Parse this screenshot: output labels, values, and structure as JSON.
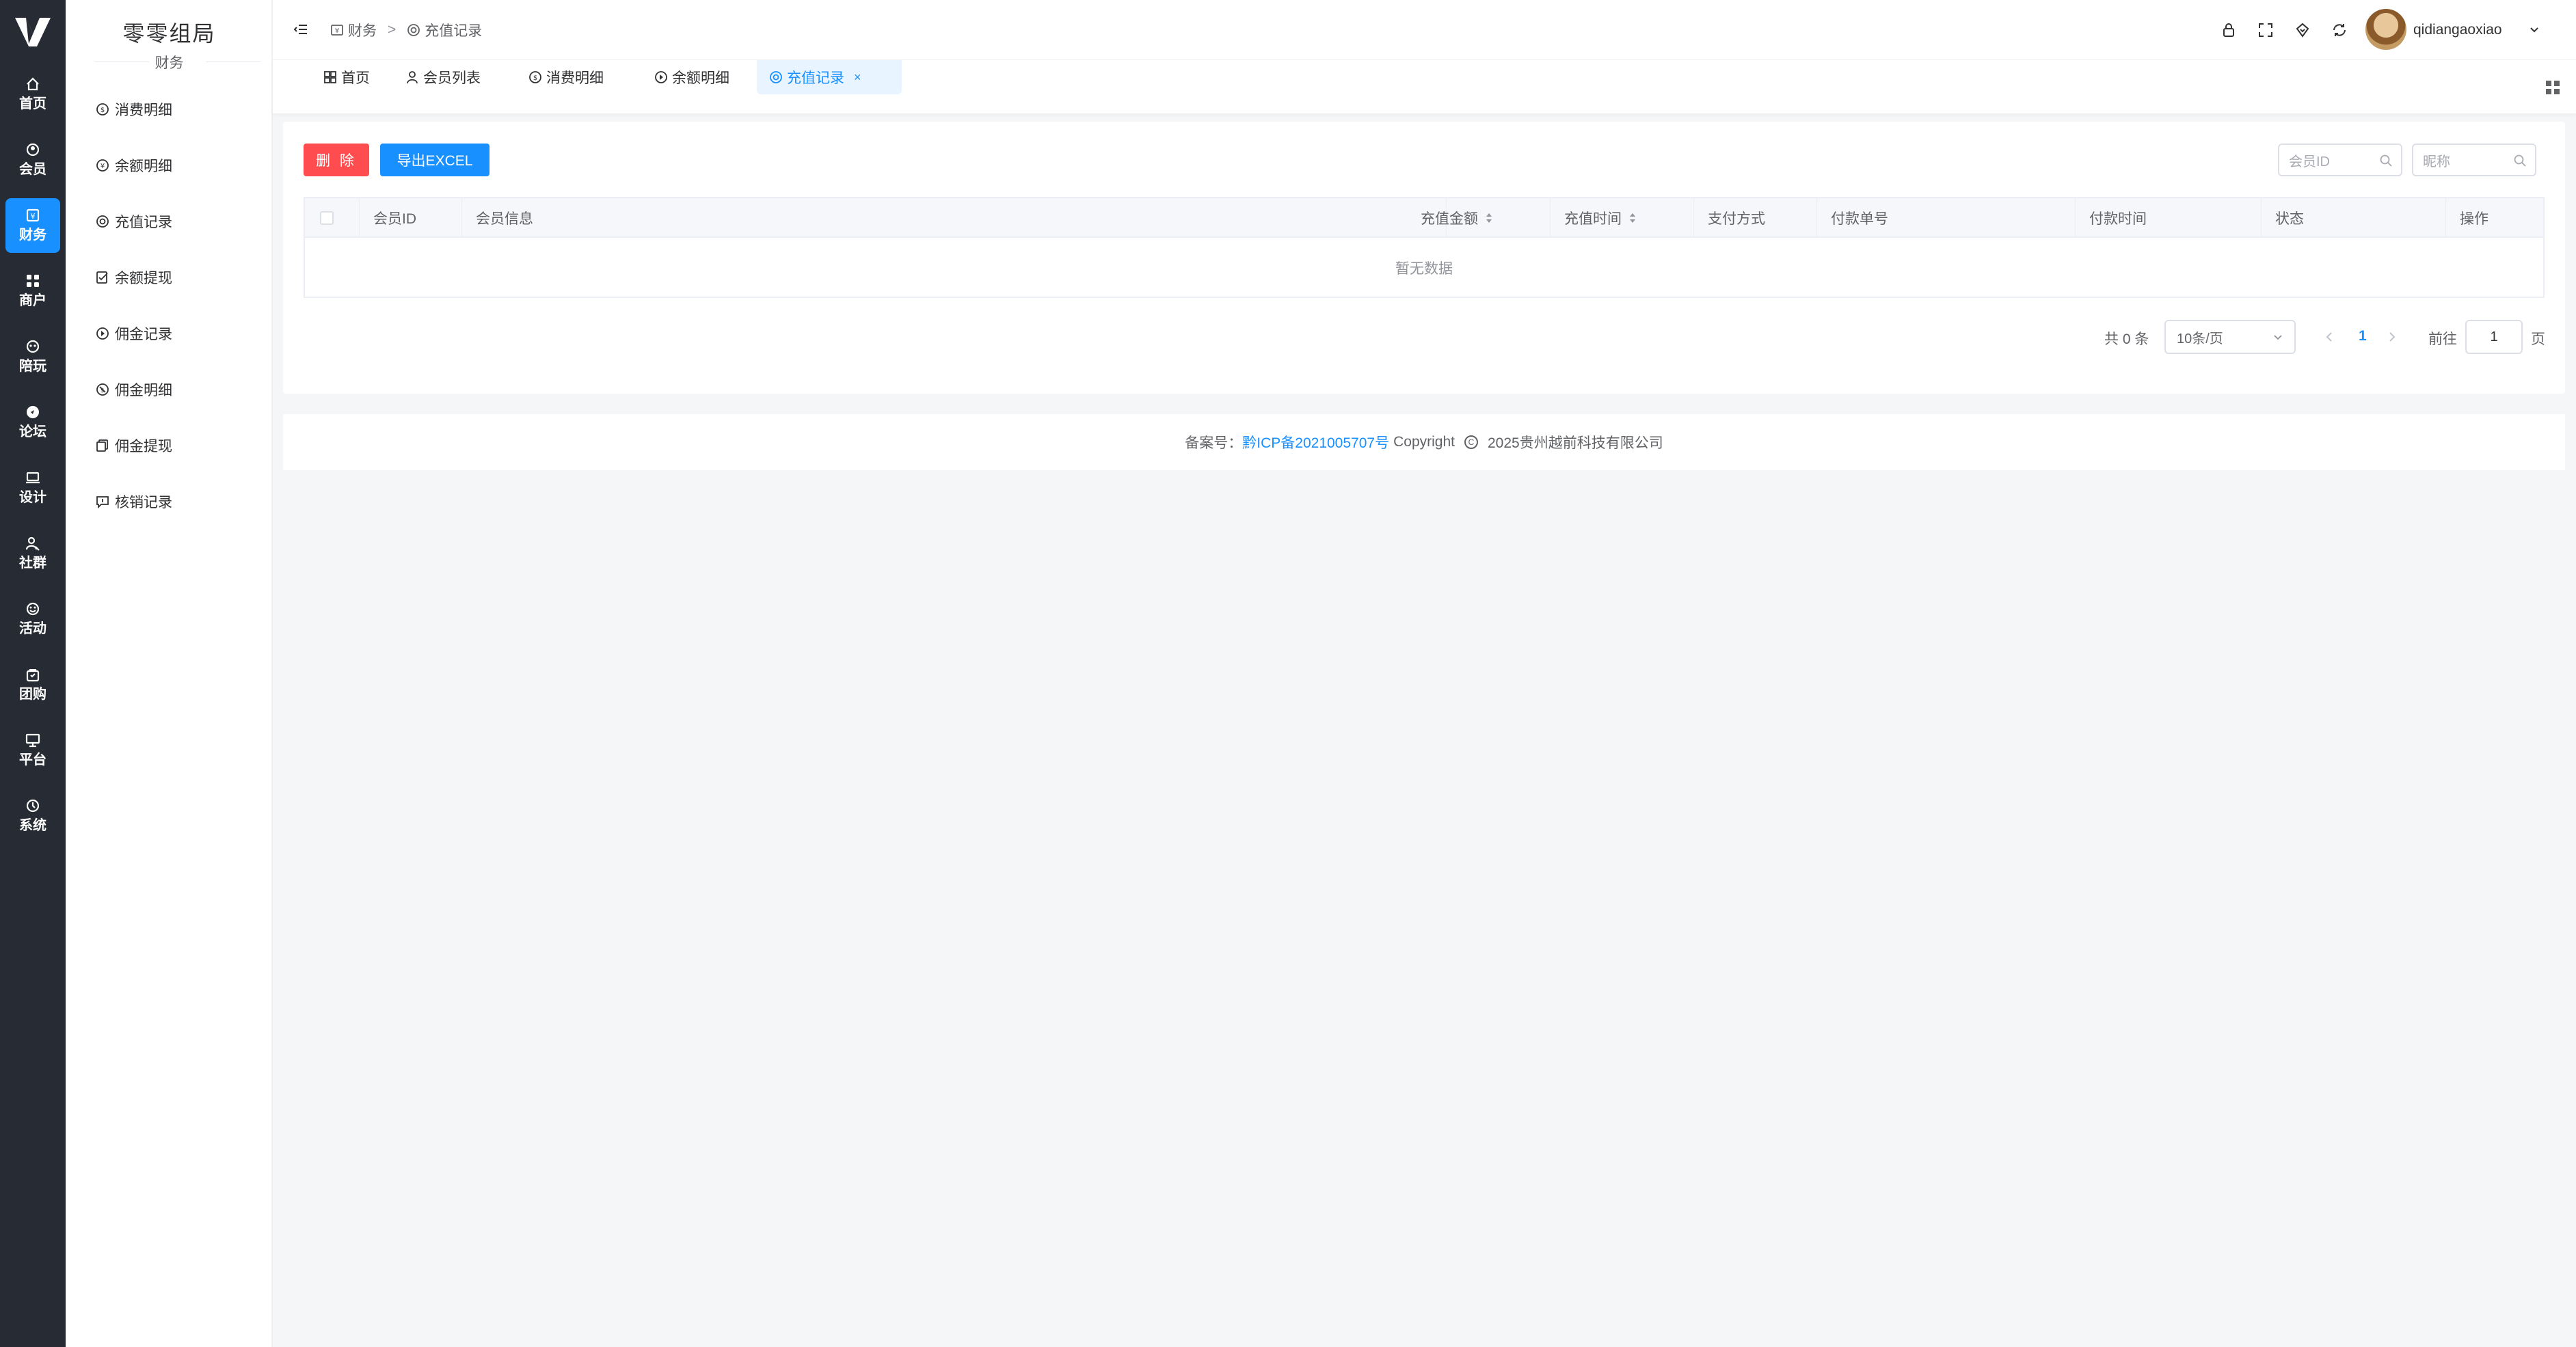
{
  "app": {
    "title": "零零组局",
    "section": "财务"
  },
  "rail": {
    "items": [
      {
        "label": "首页",
        "icon": "home-icon"
      },
      {
        "label": "会员",
        "icon": "member-icon"
      },
      {
        "label": "财务",
        "icon": "finance-icon",
        "active": true
      },
      {
        "label": "商户",
        "icon": "merchant-icon"
      },
      {
        "label": "陪玩",
        "icon": "companion-icon"
      },
      {
        "label": "论坛",
        "icon": "forum-icon"
      },
      {
        "label": "设计",
        "icon": "design-icon"
      },
      {
        "label": "社群",
        "icon": "community-icon"
      },
      {
        "label": "活动",
        "icon": "activity-icon"
      },
      {
        "label": "团购",
        "icon": "groupbuy-icon"
      },
      {
        "label": "平台",
        "icon": "platform-icon"
      },
      {
        "label": "系统",
        "icon": "system-icon"
      }
    ]
  },
  "sidebar": {
    "items": [
      {
        "label": "消费明细",
        "icon": "consume-icon"
      },
      {
        "label": "余额明细",
        "icon": "balance-icon"
      },
      {
        "label": "充值记录",
        "icon": "recharge-icon"
      },
      {
        "label": "余额提现",
        "icon": "withdraw-icon"
      },
      {
        "label": "佣金记录",
        "icon": "commission-icon"
      },
      {
        "label": "佣金明细",
        "icon": "commission-detail-icon"
      },
      {
        "label": "佣金提现",
        "icon": "commission-withdraw-icon"
      },
      {
        "label": "核销记录",
        "icon": "verify-icon"
      }
    ]
  },
  "header": {
    "breadcrumb": [
      {
        "label": "财务",
        "icon": "finance-icon"
      },
      {
        "label": "充值记录",
        "icon": "recharge-icon"
      }
    ],
    "separator": ">",
    "username": "qidiangaoxiao"
  },
  "tabs": [
    {
      "label": "首页",
      "icon": "dashboard-icon"
    },
    {
      "label": "会员列表",
      "icon": "user-icon"
    },
    {
      "label": "消费明细",
      "icon": "consume-icon"
    },
    {
      "label": "余额明细",
      "icon": "balance-icon"
    },
    {
      "label": "充值记录",
      "icon": "recharge-icon",
      "active": true,
      "close": "×"
    }
  ],
  "toolbar": {
    "delete_label": "删 除",
    "export_label": "导出EXCEL",
    "search_member_id_placeholder": "会员ID",
    "search_nickname_placeholder": "昵称"
  },
  "table": {
    "columns": [
      "会员ID",
      "会员信息",
      "充值金额",
      "充值时间",
      "支付方式",
      "付款单号",
      "付款时间",
      "状态",
      "操作"
    ],
    "empty_text": "暂无数据"
  },
  "pagination": {
    "total_text": "共 0 条",
    "page_size": "10条/页",
    "current_page": "1",
    "goto_label": "前往",
    "goto_value": "1",
    "page_unit": "页"
  },
  "footer": {
    "icp_prefix": "备案号：",
    "icp_link": "黔ICP备2021005707号",
    "copyright": "Copyright",
    "company": "2025贵州越前科技有限公司"
  },
  "colors": {
    "rail_bg": "#262b34",
    "accent": "#1890ff",
    "danger": "#ff4d4f",
    "page_bg": "#f5f6f8"
  }
}
